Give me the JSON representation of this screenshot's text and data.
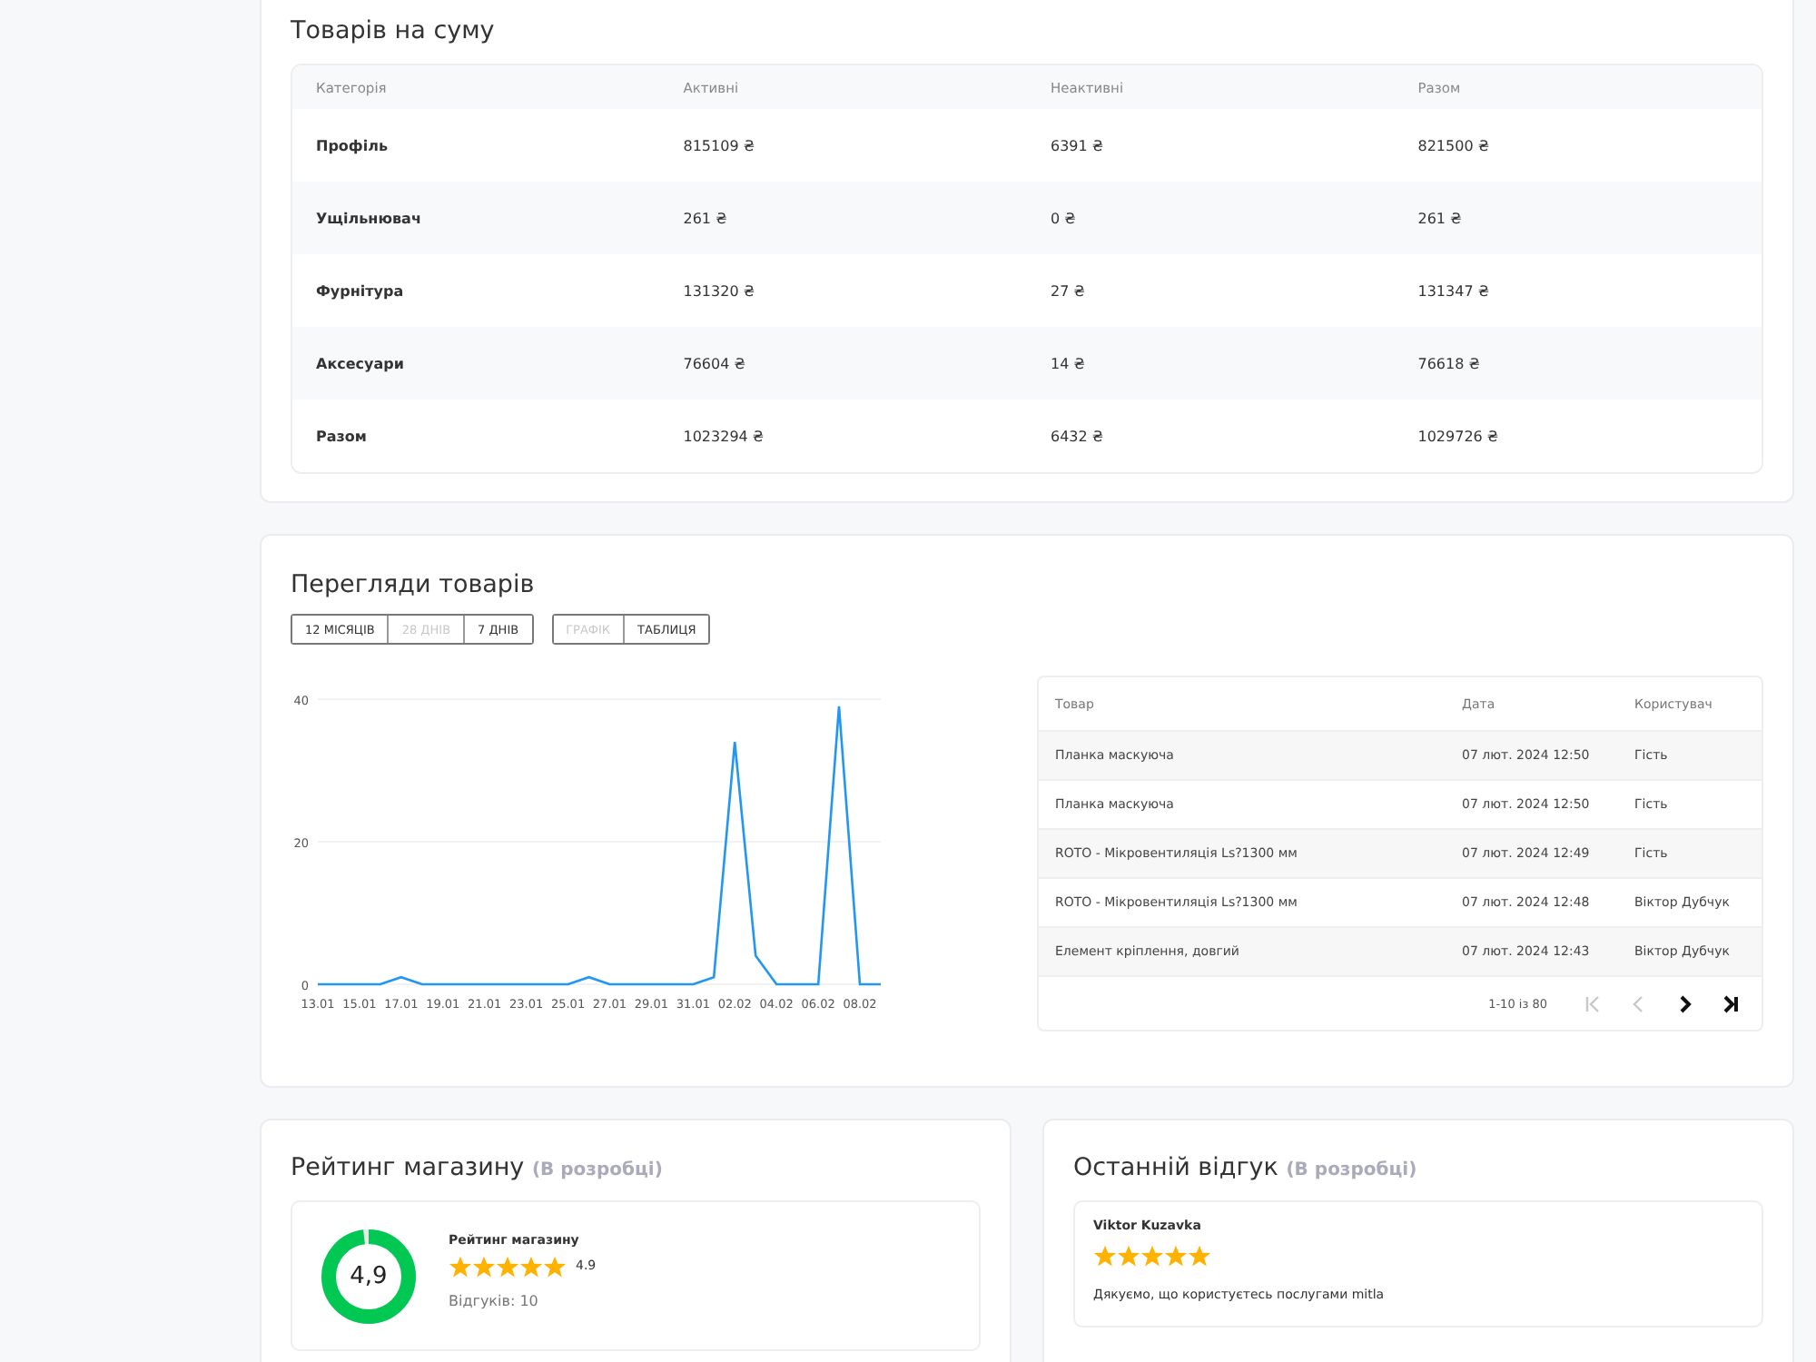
{
  "sum_card": {
    "title": "Товарів на суму",
    "columns": [
      "Категорія",
      "Активні",
      "Неактивні",
      "Разом"
    ],
    "rows": [
      [
        "Профіль",
        "815109 ₴",
        "6391 ₴",
        "821500 ₴"
      ],
      [
        "Ущільнювач",
        "261 ₴",
        "0 ₴",
        "261 ₴"
      ],
      [
        "Фурнітура",
        "131320 ₴",
        "27 ₴",
        "131347 ₴"
      ],
      [
        "Аксесуари",
        "76604 ₴",
        "14 ₴",
        "76618 ₴"
      ],
      [
        "Разом",
        "1023294 ₴",
        "6432 ₴",
        "1029726 ₴"
      ]
    ]
  },
  "views_card": {
    "title": "Перегляди товарів",
    "period_buttons": [
      {
        "label": "12 МІСЯЦІВ",
        "selected": false
      },
      {
        "label": "28 ДНІВ",
        "selected": true
      },
      {
        "label": "7 ДНІВ",
        "selected": false
      }
    ],
    "view_buttons": [
      {
        "label": "ГРАФІК",
        "selected": true
      },
      {
        "label": "ТАБЛИЦЯ",
        "selected": false
      }
    ],
    "chart_data": {
      "type": "line",
      "categories": [
        "13.01",
        null,
        "15.01",
        null,
        "17.01",
        null,
        "19.01",
        null,
        "21.01",
        null,
        "23.01",
        null,
        "25.01",
        null,
        "27.01",
        null,
        "29.01",
        null,
        "31.01",
        null,
        "02.02",
        null,
        "04.02",
        null,
        "06.02",
        null,
        "08.02",
        null
      ],
      "series": [
        {
          "color": "#2196f3",
          "values": [
            0,
            0,
            0,
            0,
            1,
            0,
            0,
            0,
            0,
            0,
            0,
            0,
            0,
            1,
            0,
            0,
            0,
            0,
            0,
            1,
            34,
            4,
            0,
            0,
            0,
            39,
            0,
            0
          ]
        }
      ],
      "ylim": [
        0,
        40
      ],
      "yticks": [
        0,
        20,
        40
      ]
    },
    "table": {
      "columns": [
        "Товар",
        "Дата",
        "Користувач"
      ],
      "rows": [
        [
          "Планка маскуюча",
          "07 лют. 2024 12:50",
          "Гість"
        ],
        [
          "Планка маскуюча",
          "07 лют. 2024 12:50",
          "Гість"
        ],
        [
          "ROTO - Мікровентиляція Ls?1300 мм",
          "07 лют. 2024 12:49",
          "Гість"
        ],
        [
          "ROTO - Мікровентиляція Ls?1300 мм",
          "07 лют. 2024 12:48",
          "Віктор Дубчук"
        ],
        [
          "Елемент кріплення, довгий",
          "07 лют. 2024 12:43",
          "Віктор Дубчук"
        ]
      ],
      "range": "1-10 із 80",
      "pager": [
        {
          "kind": "first",
          "disabled": true
        },
        {
          "kind": "prev",
          "disabled": true
        },
        {
          "kind": "next",
          "disabled": false
        },
        {
          "kind": "last",
          "disabled": false
        }
      ]
    }
  },
  "rating_card": {
    "title": "Рейтинг магазину",
    "note": "(В розробці)",
    "score": "4,9",
    "level": 0.98,
    "label": "Рейтинг магазину",
    "stars": 5,
    "value": "4.9",
    "reviews": "Відгуків: 10"
  },
  "review_card": {
    "title": "Останній відгук",
    "note": "(В розробці)",
    "author": "Viktor Kuzavka",
    "stars": 5,
    "text": "Дякуємо, що користуєтесь послугами mitla"
  }
}
